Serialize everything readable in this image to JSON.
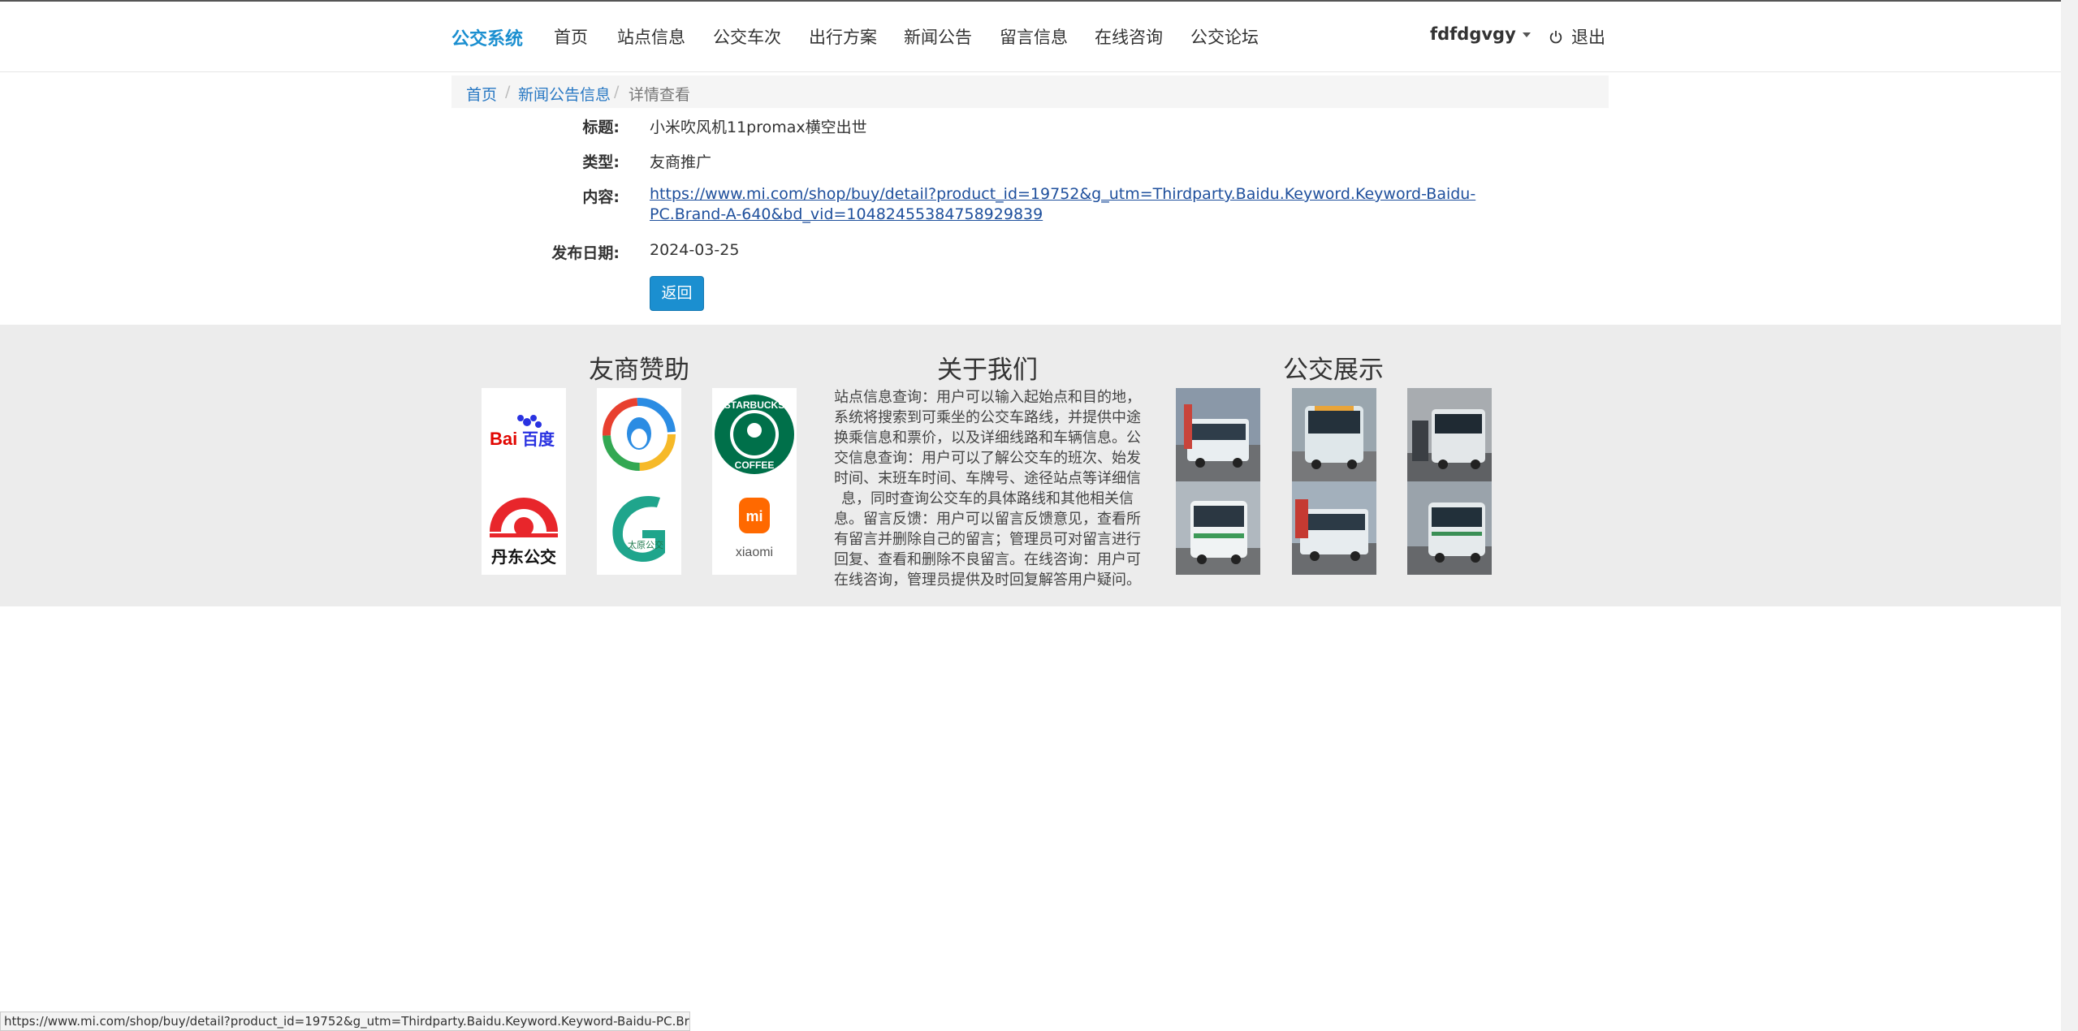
{
  "nav": {
    "brand": "公交系统",
    "items": [
      "首页",
      "站点信息",
      "公交车次",
      "出行方案",
      "新闻公告",
      "留言信息",
      "在线咨询",
      "公交论坛"
    ],
    "user": "fdfdgvgy",
    "logout": "退出"
  },
  "breadcrumb": {
    "home": "首页",
    "list": "新闻公告信息",
    "current": "详情查看",
    "separator": "/"
  },
  "detail": {
    "title_label": "标题:",
    "title_value": "小米吹风机11promax横空出世",
    "type_label": "类型:",
    "type_value": "友商推广",
    "content_label": "内容:",
    "content_value": "https://www.mi.com/shop/buy/detail?product_id=19752&g_utm=Thirdparty.Baidu.Keyword.Keyword-Baidu-PC.Brand-A-640&bd_vid=10482455384758929839",
    "date_label": "发布日期:",
    "date_value": "2024-03-25",
    "back_button": "返回"
  },
  "footer": {
    "sponsors_title": "友商赞助",
    "about_title": "关于我们",
    "buses_title": "公交展示",
    "about_text": "站点信息查询：用户可以输入起始点和目的地，系统将搜索到可乘坐的公交车路线，并提供中途换乘信息和票价，以及详细线路和车辆信息。公交信息查询：用户可以了解公交车的班次、始发时间、末班车时间、车牌号、途径站点等详细信息，同时查询公交车的具体路线和其他相关信息。留言反馈：用户可以留言反馈意见，查看所有留言并删除自己的留言；管理员可对留言进行回复、查看和删除不良留言。在线咨询：用户可在线咨询，管理员提供及时回复解答用户疑问。",
    "sponsor_logos": {
      "baidu": "百度",
      "starbucks_top": "STARBUCKS",
      "starbucks_bottom": "COFFEE",
      "dandong": "丹东公交",
      "taiyuan": "太原公交",
      "xiaomi_mark": "mi",
      "xiaomi_text": "xiaomi"
    }
  },
  "status_bar": "https://www.mi.com/shop/buy/detail?product_id=19752&g_utm=Thirdparty.Baidu.Keyword.Keyword-Baidu-PC.Bra...",
  "colors": {
    "accent": "#1b8fd0",
    "link": "#2878c3",
    "footer_bg": "#ececec"
  }
}
